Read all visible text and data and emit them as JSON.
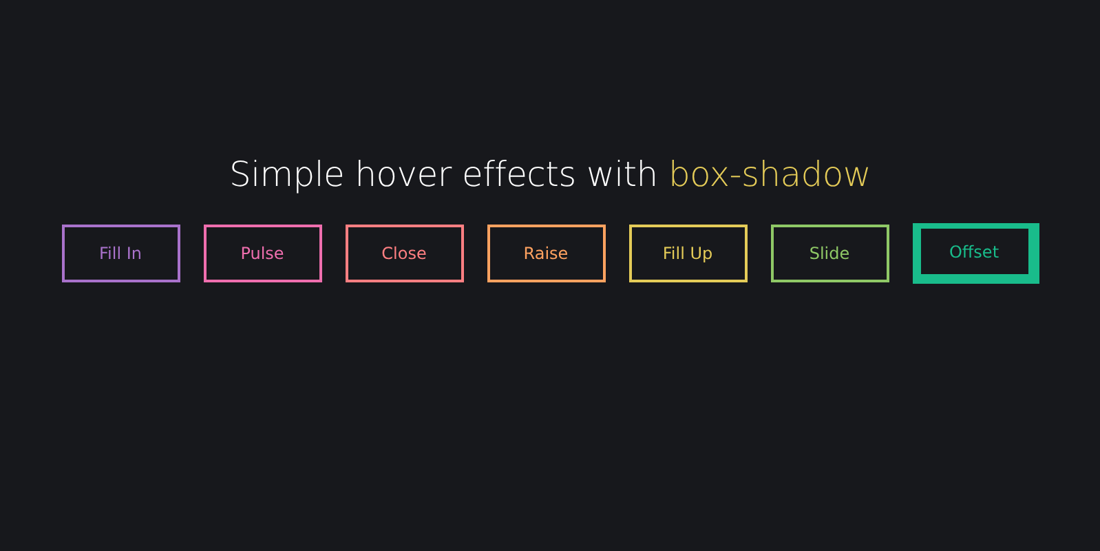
{
  "heading": {
    "text": "Simple hover effects with ",
    "highlight": "box-shadow"
  },
  "buttons": [
    {
      "label": "Fill In",
      "color": "#a972cb",
      "hovered": false
    },
    {
      "label": "Pulse",
      "color": "#ef6eae",
      "hovered": false
    },
    {
      "label": "Close",
      "color": "#ff7f82",
      "hovered": false
    },
    {
      "label": "Raise",
      "color": "#ffa260",
      "hovered": false
    },
    {
      "label": "Fill Up",
      "color": "#e4cb58",
      "hovered": false
    },
    {
      "label": "Slide",
      "color": "#8fc866",
      "hovered": false
    },
    {
      "label": "Offset",
      "color": "#19bc8b",
      "hovered": true
    }
  ]
}
